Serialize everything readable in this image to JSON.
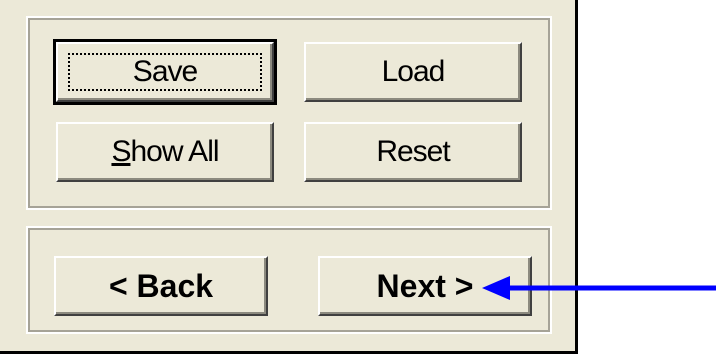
{
  "buttons": {
    "save": {
      "label_prefix": "S",
      "label_rest": "ave"
    },
    "load": {
      "label": "Load"
    },
    "show_all": {
      "label_prefix": "S",
      "label_rest": "how All"
    },
    "reset": {
      "label": "Reset"
    },
    "back": {
      "label": "< Back"
    },
    "next": {
      "label": "Next >"
    }
  },
  "colors": {
    "dialog_bg": "#ece9d8",
    "arrow": "#0000ff"
  },
  "annotation": {
    "icon": "pointer-arrow-icon"
  }
}
